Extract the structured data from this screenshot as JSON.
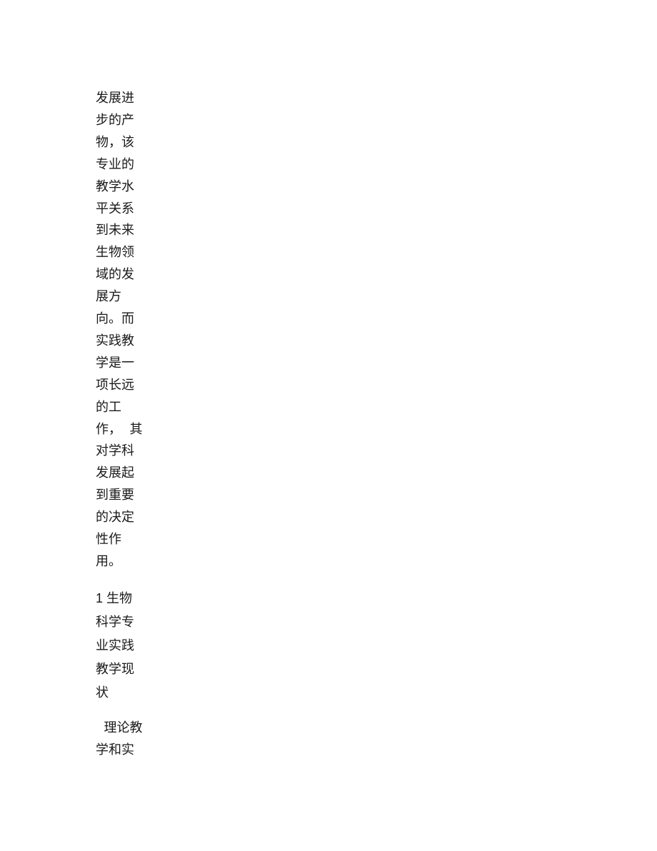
{
  "document": {
    "paragraphs": [
      {
        "type": "body",
        "lines": [
          "发展进",
          "步的产",
          "物，该",
          "专业的",
          "教学水",
          "平关系",
          "到未来",
          "生物领",
          "域的发",
          "展方",
          "向。而",
          "实践教",
          "学是一",
          "项长远",
          "的工",
          "作，  其",
          "对学科",
          "发展起",
          "到重要",
          "的决定",
          "性作",
          "用。"
        ]
      },
      {
        "type": "heading",
        "lines": [
          "1 生物",
          "科学专",
          "业实践",
          "教学现",
          "状"
        ]
      },
      {
        "type": "body",
        "lines": [
          "  理论教",
          "学和实"
        ]
      }
    ]
  }
}
